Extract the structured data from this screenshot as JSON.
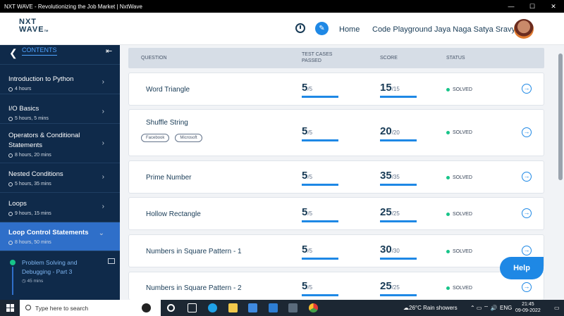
{
  "window": {
    "title": "NXT WAVE - Revolutionizing the Job Market | NxtWave",
    "minimize": "—",
    "maximize": "☐",
    "close": "✕"
  },
  "header": {
    "logo_line1": "NXT",
    "logo_line2": "WAVE",
    "logo_tm": "TM",
    "home": "Home",
    "playground": "Code Playground",
    "user": "Jaya Naga Satya Sravya",
    "chat_glyph": "✎"
  },
  "sidebar": {
    "back_glyph": "❮",
    "title": "CONTENTS",
    "collapse_glyph": "⇤",
    "items": [
      {
        "label": "Introduction to Python",
        "duration": "4 hours"
      },
      {
        "label": "I/O Basics",
        "duration": "5 hours, 5 mins"
      },
      {
        "label": "Operators & Conditional Statements",
        "duration": "8 hours, 20 mins"
      },
      {
        "label": "Nested Conditions",
        "duration": "5 hours, 35 mins"
      },
      {
        "label": "Loops",
        "duration": "9 hours, 15 mins"
      },
      {
        "label": "Loop Control Statements",
        "duration": "8 hours, 50 mins"
      }
    ],
    "sub_item": {
      "label": "Problem Solving and Debugging - Part 3",
      "duration": "45 mins"
    },
    "chevron": "›",
    "chevron_down": "⌄"
  },
  "table": {
    "headers": {
      "question": "QUESTION",
      "test_cases_1": "TEST CASES",
      "test_cases_2": "PASSED",
      "score": "SCORE",
      "status": "STATUS"
    },
    "rows": [
      {
        "name": "Word Triangle",
        "passed": "5",
        "total": "/5",
        "score": "15",
        "max": "/15",
        "status": "SOLVED",
        "tags": []
      },
      {
        "name": "Shuffle String",
        "passed": "5",
        "total": "/5",
        "score": "20",
        "max": "/20",
        "status": "SOLVED",
        "tags": [
          "Facebook",
          "Microsoft"
        ]
      },
      {
        "name": "Prime Number",
        "passed": "5",
        "total": "/5",
        "score": "35",
        "max": "/35",
        "status": "SOLVED",
        "tags": []
      },
      {
        "name": "Hollow Rectangle",
        "passed": "5",
        "total": "/5",
        "score": "25",
        "max": "/25",
        "status": "SOLVED",
        "tags": []
      },
      {
        "name": "Numbers in Square Pattern - 1",
        "passed": "5",
        "total": "/5",
        "score": "30",
        "max": "/30",
        "status": "SOLVED",
        "tags": []
      },
      {
        "name": "Numbers in Square Pattern - 2",
        "passed": "5",
        "total": "/5",
        "score": "25",
        "max": "/25",
        "status": "SOLVED",
        "tags": []
      }
    ],
    "go_glyph": "→"
  },
  "help": {
    "label": "Help"
  },
  "taskbar": {
    "search_placeholder": "Type here to search",
    "weather": "26°C  Rain showers",
    "lang": "ENG",
    "time": "21:45",
    "date": "09-09-2022",
    "tray_glyphs": "⌃  ▭  ⌔  🔊"
  },
  "colors": {
    "primary": "#1e88e5",
    "sidebar": "#0f2a4a",
    "active": "#2f6fc9",
    "solved": "#17c489",
    "text": "#183b56"
  }
}
